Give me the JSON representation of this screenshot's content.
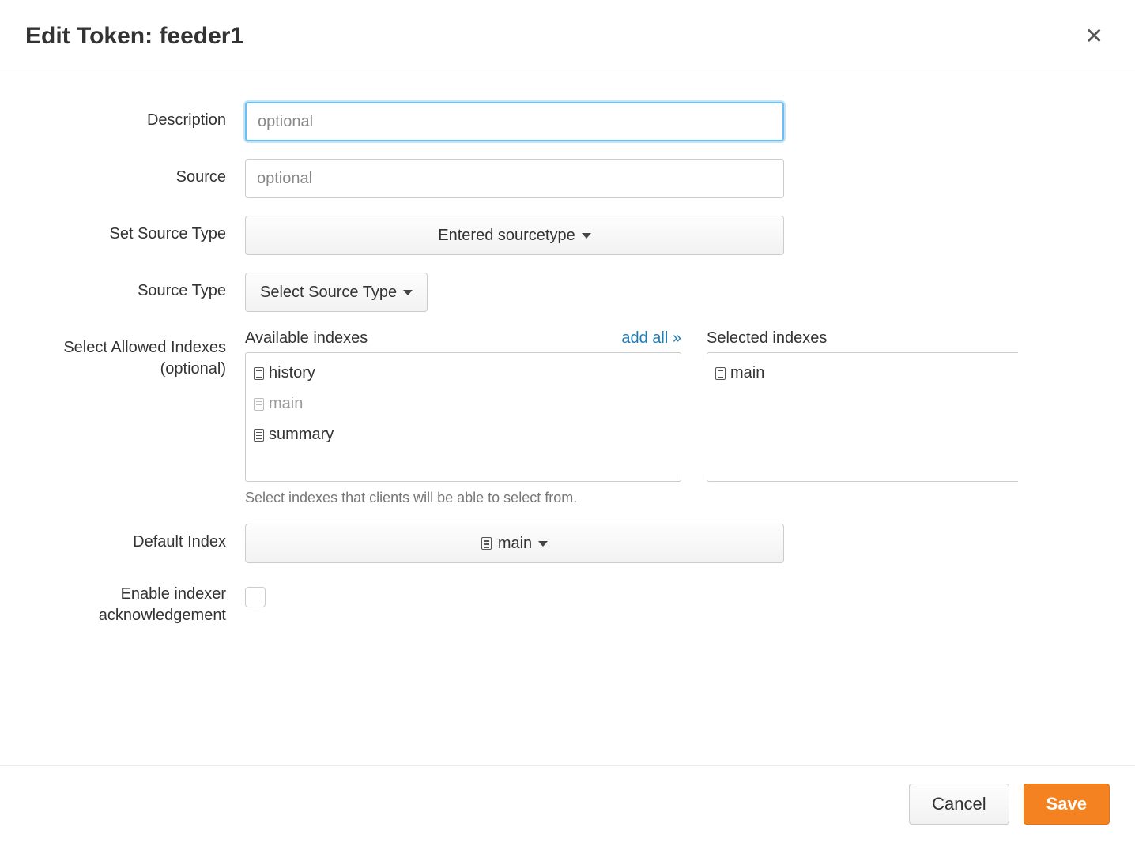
{
  "header": {
    "title": "Edit Token: feeder1"
  },
  "labels": {
    "description": "Description",
    "source": "Source",
    "set_source_type": "Set Source Type",
    "source_type": "Source Type",
    "select_allowed_indexes": "Select Allowed Indexes (optional)",
    "default_index": "Default Index",
    "enable_ack": "Enable indexer acknowledgement"
  },
  "fields": {
    "description_value": "",
    "description_placeholder": "optional",
    "source_value": "",
    "source_placeholder": "optional",
    "set_source_type_selected": "Entered sourcetype",
    "source_type_selected": "Select Source Type",
    "default_index_selected": "main",
    "enable_ack_checked": false
  },
  "indexes": {
    "available_title": "Available indexes",
    "selected_title": "Selected indexes",
    "add_all_label": "add all »",
    "available": [
      "history",
      "main",
      "summary"
    ],
    "already_selected_in_available": [
      "main"
    ],
    "selected": [
      "main"
    ],
    "helper": "Select indexes that clients will be able to select from."
  },
  "footer": {
    "cancel": "Cancel",
    "save": "Save"
  }
}
